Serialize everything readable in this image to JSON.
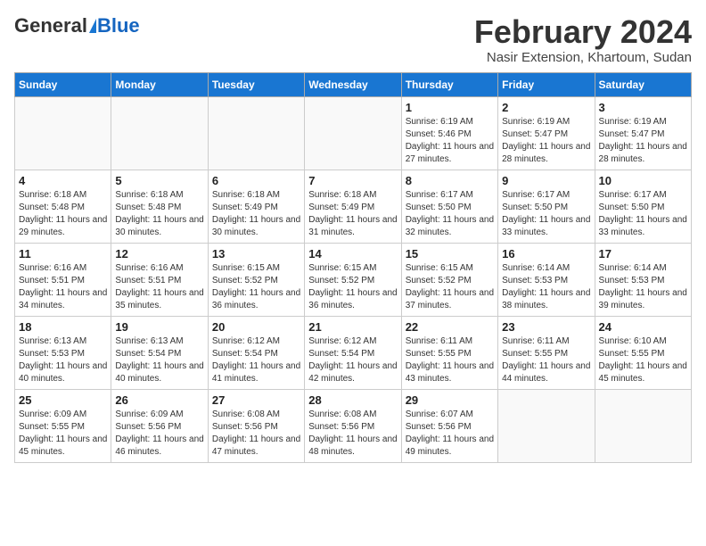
{
  "logo": {
    "general": "General",
    "blue": "Blue"
  },
  "title": "February 2024",
  "subtitle": "Nasir Extension, Khartoum, Sudan",
  "days_of_week": [
    "Sunday",
    "Monday",
    "Tuesday",
    "Wednesday",
    "Thursday",
    "Friday",
    "Saturday"
  ],
  "weeks": [
    [
      {
        "day": "",
        "info": ""
      },
      {
        "day": "",
        "info": ""
      },
      {
        "day": "",
        "info": ""
      },
      {
        "day": "",
        "info": ""
      },
      {
        "day": "1",
        "info": "Sunrise: 6:19 AM\nSunset: 5:46 PM\nDaylight: 11 hours and 27 minutes."
      },
      {
        "day": "2",
        "info": "Sunrise: 6:19 AM\nSunset: 5:47 PM\nDaylight: 11 hours and 28 minutes."
      },
      {
        "day": "3",
        "info": "Sunrise: 6:19 AM\nSunset: 5:47 PM\nDaylight: 11 hours and 28 minutes."
      }
    ],
    [
      {
        "day": "4",
        "info": "Sunrise: 6:18 AM\nSunset: 5:48 PM\nDaylight: 11 hours and 29 minutes."
      },
      {
        "day": "5",
        "info": "Sunrise: 6:18 AM\nSunset: 5:48 PM\nDaylight: 11 hours and 30 minutes."
      },
      {
        "day": "6",
        "info": "Sunrise: 6:18 AM\nSunset: 5:49 PM\nDaylight: 11 hours and 30 minutes."
      },
      {
        "day": "7",
        "info": "Sunrise: 6:18 AM\nSunset: 5:49 PM\nDaylight: 11 hours and 31 minutes."
      },
      {
        "day": "8",
        "info": "Sunrise: 6:17 AM\nSunset: 5:50 PM\nDaylight: 11 hours and 32 minutes."
      },
      {
        "day": "9",
        "info": "Sunrise: 6:17 AM\nSunset: 5:50 PM\nDaylight: 11 hours and 33 minutes."
      },
      {
        "day": "10",
        "info": "Sunrise: 6:17 AM\nSunset: 5:50 PM\nDaylight: 11 hours and 33 minutes."
      }
    ],
    [
      {
        "day": "11",
        "info": "Sunrise: 6:16 AM\nSunset: 5:51 PM\nDaylight: 11 hours and 34 minutes."
      },
      {
        "day": "12",
        "info": "Sunrise: 6:16 AM\nSunset: 5:51 PM\nDaylight: 11 hours and 35 minutes."
      },
      {
        "day": "13",
        "info": "Sunrise: 6:15 AM\nSunset: 5:52 PM\nDaylight: 11 hours and 36 minutes."
      },
      {
        "day": "14",
        "info": "Sunrise: 6:15 AM\nSunset: 5:52 PM\nDaylight: 11 hours and 36 minutes."
      },
      {
        "day": "15",
        "info": "Sunrise: 6:15 AM\nSunset: 5:52 PM\nDaylight: 11 hours and 37 minutes."
      },
      {
        "day": "16",
        "info": "Sunrise: 6:14 AM\nSunset: 5:53 PM\nDaylight: 11 hours and 38 minutes."
      },
      {
        "day": "17",
        "info": "Sunrise: 6:14 AM\nSunset: 5:53 PM\nDaylight: 11 hours and 39 minutes."
      }
    ],
    [
      {
        "day": "18",
        "info": "Sunrise: 6:13 AM\nSunset: 5:53 PM\nDaylight: 11 hours and 40 minutes."
      },
      {
        "day": "19",
        "info": "Sunrise: 6:13 AM\nSunset: 5:54 PM\nDaylight: 11 hours and 40 minutes."
      },
      {
        "day": "20",
        "info": "Sunrise: 6:12 AM\nSunset: 5:54 PM\nDaylight: 11 hours and 41 minutes."
      },
      {
        "day": "21",
        "info": "Sunrise: 6:12 AM\nSunset: 5:54 PM\nDaylight: 11 hours and 42 minutes."
      },
      {
        "day": "22",
        "info": "Sunrise: 6:11 AM\nSunset: 5:55 PM\nDaylight: 11 hours and 43 minutes."
      },
      {
        "day": "23",
        "info": "Sunrise: 6:11 AM\nSunset: 5:55 PM\nDaylight: 11 hours and 44 minutes."
      },
      {
        "day": "24",
        "info": "Sunrise: 6:10 AM\nSunset: 5:55 PM\nDaylight: 11 hours and 45 minutes."
      }
    ],
    [
      {
        "day": "25",
        "info": "Sunrise: 6:09 AM\nSunset: 5:55 PM\nDaylight: 11 hours and 45 minutes."
      },
      {
        "day": "26",
        "info": "Sunrise: 6:09 AM\nSunset: 5:56 PM\nDaylight: 11 hours and 46 minutes."
      },
      {
        "day": "27",
        "info": "Sunrise: 6:08 AM\nSunset: 5:56 PM\nDaylight: 11 hours and 47 minutes."
      },
      {
        "day": "28",
        "info": "Sunrise: 6:08 AM\nSunset: 5:56 PM\nDaylight: 11 hours and 48 minutes."
      },
      {
        "day": "29",
        "info": "Sunrise: 6:07 AM\nSunset: 5:56 PM\nDaylight: 11 hours and 49 minutes."
      },
      {
        "day": "",
        "info": ""
      },
      {
        "day": "",
        "info": ""
      }
    ]
  ]
}
